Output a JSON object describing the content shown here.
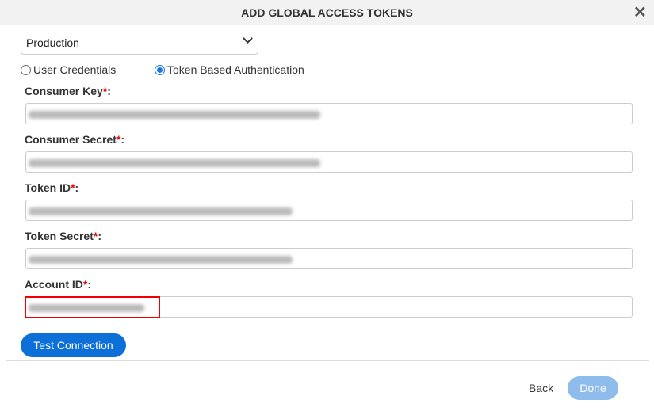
{
  "dialog": {
    "title": "ADD GLOBAL ACCESS TOKENS",
    "close_icon": "close-icon"
  },
  "environment": {
    "selected": "Production"
  },
  "auth": {
    "options": [
      {
        "label": "User Credentials",
        "selected": false
      },
      {
        "label": "Token Based Authentication",
        "selected": true
      }
    ]
  },
  "fields": [
    {
      "label": "Consumer Key",
      "required_mark": "*",
      "suffix": ":",
      "value_masked": true
    },
    {
      "label": "Consumer Secret",
      "required_mark": "*",
      "suffix": ":",
      "value_masked": true
    },
    {
      "label": "Token ID",
      "required_mark": "*",
      "suffix": ":",
      "value_masked": true
    },
    {
      "label": "Token Secret",
      "required_mark": "*",
      "suffix": ":",
      "value_masked": true
    },
    {
      "label": "Account ID",
      "required_mark": "*",
      "suffix": ":",
      "value_masked": true,
      "highlighted": true
    }
  ],
  "buttons": {
    "test_connection": "Test Connection",
    "back": "Back",
    "done": "Done"
  },
  "colors": {
    "primary": "#0c70d8",
    "done_disabled": "#8ebcec",
    "required": "#e00000",
    "highlight": "#e00000"
  }
}
